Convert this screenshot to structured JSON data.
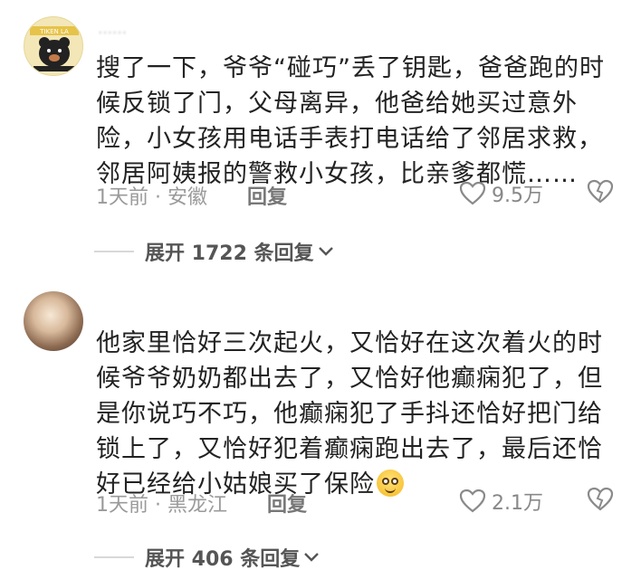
{
  "comments": [
    {
      "username": "‥‥‥",
      "lines": [
        "搜了一下，爷爷“碰巧”丢了钥匙，爸爸跑的时",
        "候反锁了门，父母离异，他爸给她买过意外",
        "险，小女孩用电话手表打电话给了邻居求救，",
        "邻居阿姨报的警救小女孩，比亲爹都慌……"
      ],
      "time_location": "1天前 · 安徽",
      "reply_label": "回复",
      "likes": "9.5万",
      "expand_label": "展开 1722 条回复"
    },
    {
      "lines": [
        "他家里恰好三次起火，又恰好在这次着火的时",
        "候爷爷奶奶都出去了，又恰好他癫痫犯了，但",
        "是你说巧不巧，他癫痫犯了手抖还恰好把门给",
        "锁上了，又恰好犯着癫痫跑出去了，最后还恰",
        "好已经给小姑娘买了保险"
      ],
      "time_location": "1天前 · 黑龙江",
      "reply_label": "回复",
      "likes": "2.1万",
      "expand_label": "展开 406 条回复"
    }
  ],
  "avatar1_text": "TIKEN LA"
}
